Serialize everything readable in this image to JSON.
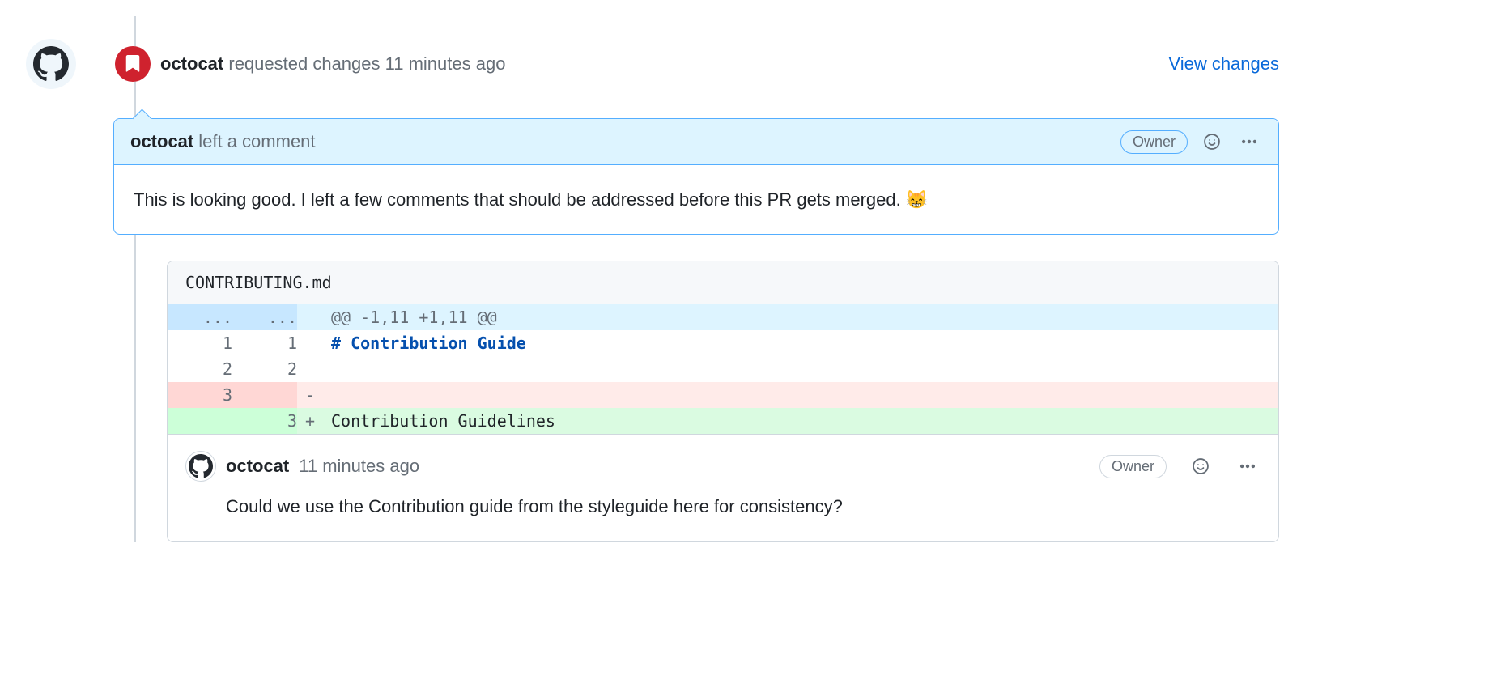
{
  "review": {
    "user": "octocat",
    "action": "requested changes",
    "time": "11 minutes ago",
    "view_changes": "View changes"
  },
  "comment_header": {
    "user": "octocat",
    "action": "left a comment",
    "owner": "Owner"
  },
  "comment_body": "This is looking good. I left a few comments that should be addressed before this PR gets merged. 😸",
  "file": {
    "name": "CONTRIBUTING.md",
    "hunk": "@@ -1,11 +1,11 @@",
    "rows": [
      {
        "old": "1",
        "new": "1",
        "marker": "",
        "text": "# Contribution Guide"
      },
      {
        "old": "2",
        "new": "2",
        "marker": "",
        "text": ""
      },
      {
        "old": "3",
        "new": "",
        "marker": "-",
        "text": ""
      },
      {
        "old": "",
        "new": "3",
        "marker": "+",
        "text": "Contribution Guidelines"
      }
    ]
  },
  "inline": {
    "user": "octocat",
    "time": "11 minutes ago",
    "owner": "Owner",
    "body": "Could we use the Contribution guide from the styleguide here for consistency?"
  },
  "hunk_dots": "..."
}
